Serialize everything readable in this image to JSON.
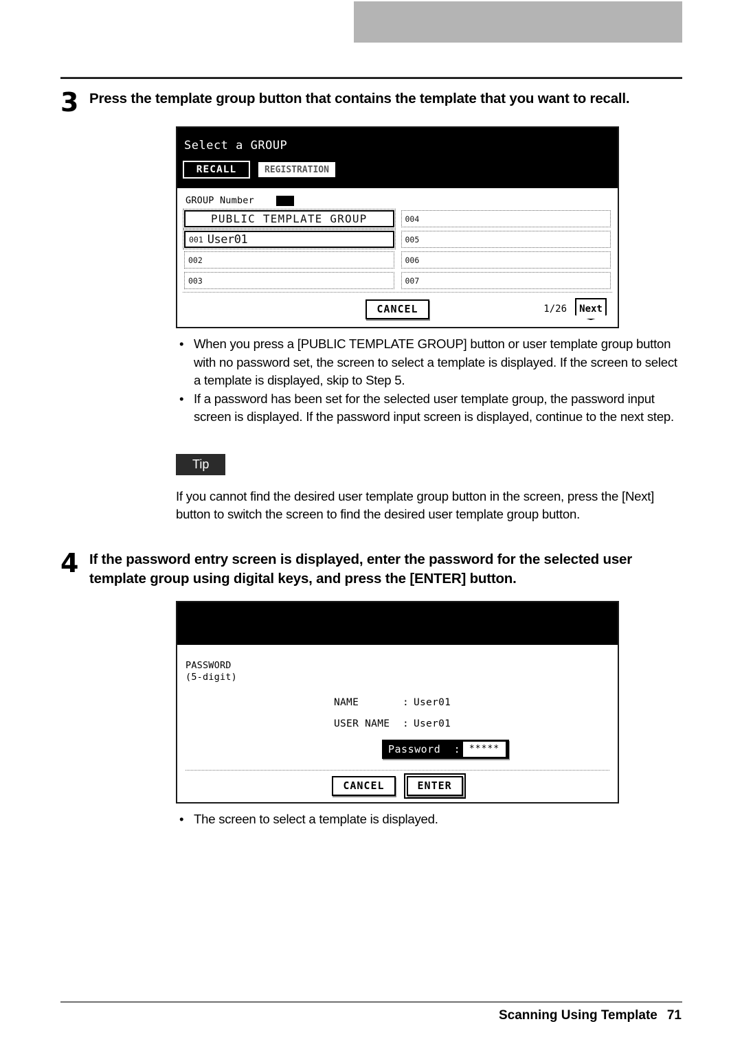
{
  "page": {
    "footer_section": "Scanning Using Template",
    "footer_page_number": "71"
  },
  "steps": [
    {
      "number": "3",
      "text": "Press the template group button that contains the template that you want to recall."
    },
    {
      "number": "4",
      "text": "If the password entry screen is displayed, enter the password for the selected user template group using digital keys, and press the [ENTER] button."
    }
  ],
  "group_screen": {
    "title": "Select a GROUP",
    "tabs": [
      {
        "label": "RECALL",
        "selected": true
      },
      {
        "label": "REGISTRATION",
        "selected": false
      }
    ],
    "group_number_label": "GROUP Number",
    "group_number_value": "",
    "items": [
      {
        "index": "",
        "name": "PUBLIC TEMPLATE GROUP",
        "selected": true,
        "centered": true
      },
      {
        "index": "001",
        "name": "User01",
        "selected": true,
        "centered": false
      },
      {
        "index": "002",
        "name": "",
        "selected": false,
        "centered": false
      },
      {
        "index": "003",
        "name": "",
        "selected": false,
        "centered": false
      },
      {
        "index": "004",
        "name": "",
        "selected": false,
        "centered": false
      },
      {
        "index": "005",
        "name": "",
        "selected": false,
        "centered": false
      },
      {
        "index": "006",
        "name": "",
        "selected": false,
        "centered": false
      },
      {
        "index": "007",
        "name": "",
        "selected": false,
        "centered": false
      }
    ],
    "cancel_label": "CANCEL",
    "page_count": "1/26",
    "next_label": "Next"
  },
  "bullets_after_group_screen": [
    "When you press a [PUBLIC TEMPLATE GROUP] button or user template group button with no password set, the screen to select a template is displayed.  If the screen to select a template is displayed, skip to Step 5.",
    "If a password has been set for the selected user template group, the password input screen is displayed.  If the password input screen is displayed, continue to the next step."
  ],
  "tip": {
    "badge": "Tip",
    "text": "If you cannot find the desired user template group button in the screen, press the [Next] button to switch the screen to find the desired user template group button."
  },
  "password_screen": {
    "title": "",
    "password_label_line1": "PASSWORD",
    "password_label_line2": "(5-digit)",
    "fields": [
      {
        "key": "NAME",
        "colon": ":",
        "value": "User01"
      },
      {
        "key": "USER NAME",
        "colon": ":",
        "value": "User01"
      }
    ],
    "input": {
      "label": "Password",
      "colon": ":",
      "value": "*****"
    },
    "cancel_label": "CANCEL",
    "enter_label": "ENTER"
  },
  "bullets_after_password_screen": [
    "The screen to select a template is displayed."
  ],
  "bullet_glyph": "•"
}
